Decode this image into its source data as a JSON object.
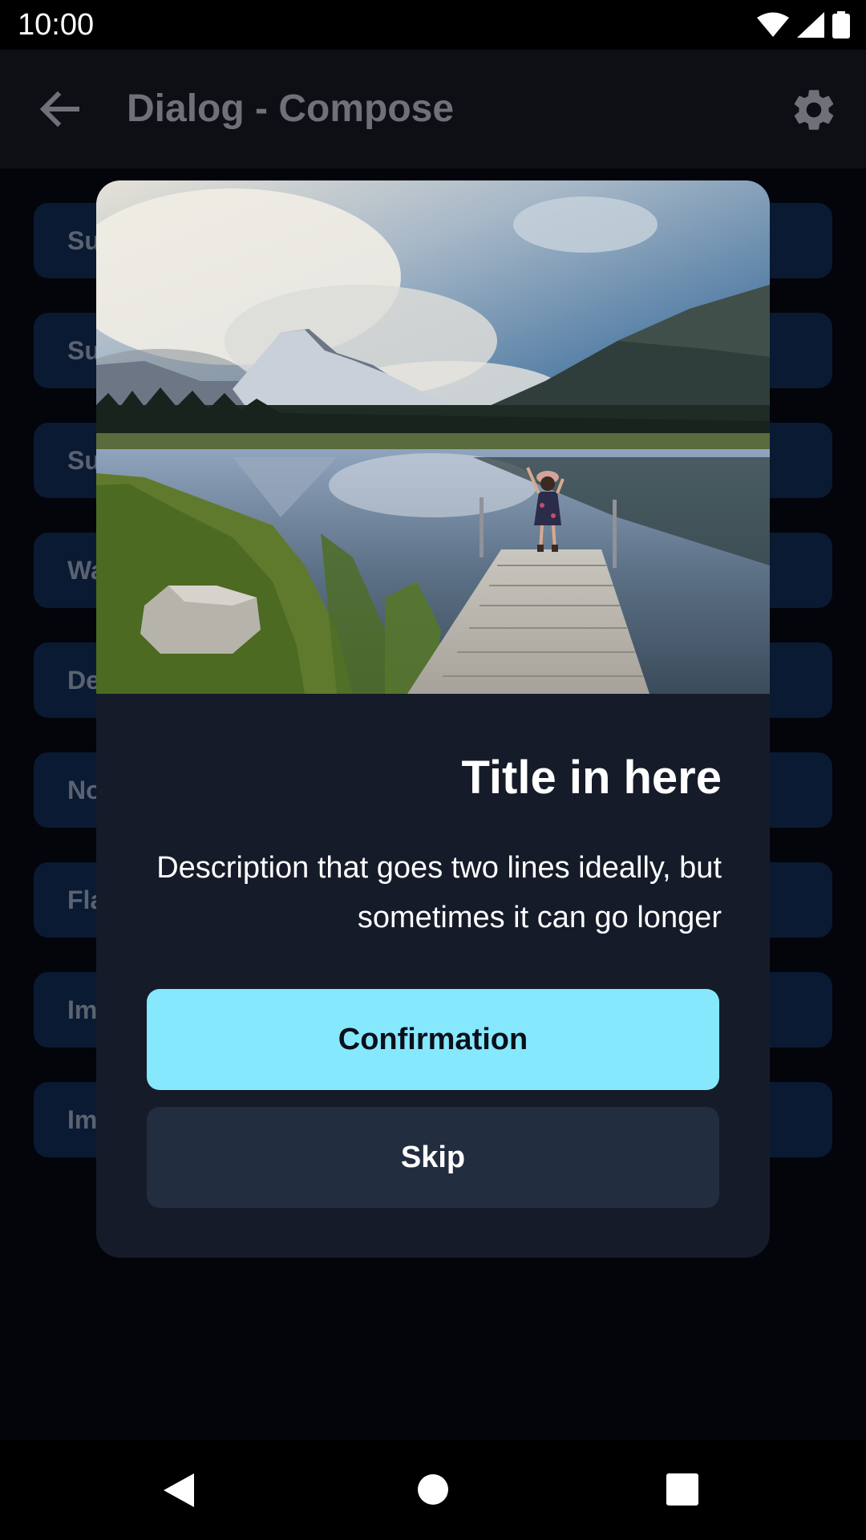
{
  "status_bar": {
    "time": "10:00",
    "icons": [
      "wifi-icon",
      "signal-icon",
      "battery-icon"
    ]
  },
  "app_bar": {
    "title": "Dialog - Compose",
    "back_icon": "arrow-back-icon",
    "settings_icon": "gear-icon"
  },
  "list": {
    "items": [
      {
        "label": "Su"
      },
      {
        "label": "Su"
      },
      {
        "label": "Su"
      },
      {
        "label": "Wa"
      },
      {
        "label": "De"
      },
      {
        "label": "No"
      },
      {
        "label": "Fla"
      },
      {
        "label": "Im"
      },
      {
        "label": "Im"
      }
    ]
  },
  "dialog": {
    "image": "lake-dock-mountain-photo",
    "title": "Title in here",
    "description": "Description that goes two lines ideally, but sometimes it can go longer",
    "primary_button": "Confirmation",
    "secondary_button": "Skip"
  },
  "nav_bar": {
    "icons": [
      "nav-back-icon",
      "nav-home-icon",
      "nav-recents-icon"
    ]
  },
  "colors": {
    "accent": "#86e8fd",
    "dialog_bg": "#151b29",
    "secondary_button": "#222d40",
    "list_item_bg": "#0a1a33"
  }
}
